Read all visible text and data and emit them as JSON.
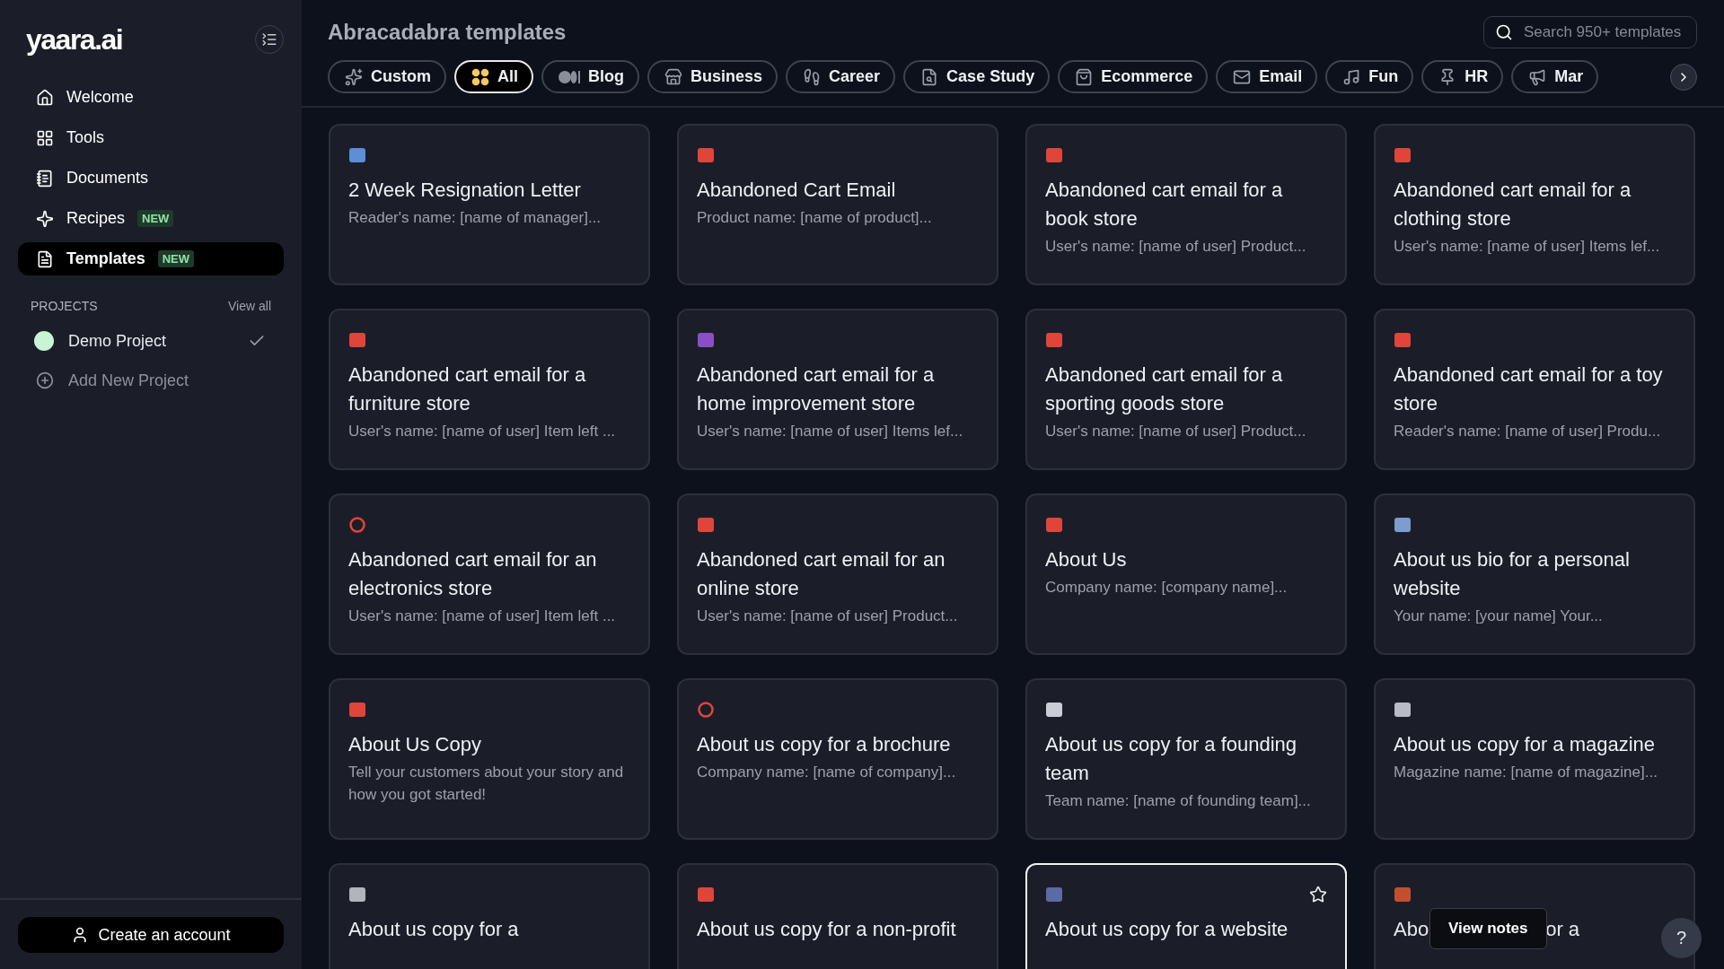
{
  "sidebar": {
    "logo": "yaara.ai",
    "nav": [
      {
        "label": "Welcome",
        "selected": false
      },
      {
        "label": "Tools",
        "selected": false
      },
      {
        "label": "Documents",
        "selected": false
      },
      {
        "label": "Recipes",
        "selected": false,
        "badge": "NEW"
      },
      {
        "label": "Templates",
        "selected": true,
        "badge": "NEW"
      }
    ],
    "projects": {
      "heading": "PROJECTS",
      "view_all": "View all",
      "items": [
        {
          "name": "Demo Project",
          "color": "#c8f5d4",
          "checked": true
        }
      ],
      "add": "Add New Project"
    },
    "account_button": "Create an account"
  },
  "main": {
    "title": "Abracadabra templates",
    "search": {
      "placeholder": "Search 950+ templates"
    },
    "filters": [
      {
        "label": "Custom",
        "selected": false
      },
      {
        "label": "All",
        "selected": true
      },
      {
        "label": "Blog",
        "selected": false
      },
      {
        "label": "Business",
        "selected": false
      },
      {
        "label": "Career",
        "selected": false
      },
      {
        "label": "Case Study",
        "selected": false
      },
      {
        "label": "Ecommerce",
        "selected": false
      },
      {
        "label": "Email",
        "selected": false
      },
      {
        "label": "Fun",
        "selected": false
      },
      {
        "label": "HR",
        "selected": false
      },
      {
        "label": "Mar",
        "selected": false
      }
    ],
    "cards": [
      {
        "title": "2 Week Resignation Letter",
        "description": "Reader's name: [name of manager]...",
        "hovered": false
      },
      {
        "title": "Abandoned Cart Email",
        "description": "Product name: [name of product]...",
        "hovered": false
      },
      {
        "title": "Abandoned cart email for a book store",
        "description": "User's name: [name of user] Product...",
        "hovered": false
      },
      {
        "title": "Abandoned cart email for a clothing store",
        "description": "User's name: [name of user] Items lef...",
        "hovered": false
      },
      {
        "title": "Abandoned cart email for a furniture store",
        "description": "User's name: [name of user] Item left ...",
        "hovered": false
      },
      {
        "title": "Abandoned cart email for a home improvement store",
        "description": "User's name: [name of user] Items lef...",
        "hovered": false
      },
      {
        "title": "Abandoned cart email for a sporting goods store",
        "description": "User's name: [name of user] Product...",
        "hovered": false
      },
      {
        "title": "Abandoned cart email for a toy store",
        "description": "Reader's name: [name of user] Produ...",
        "hovered": false
      },
      {
        "title": "Abandoned cart email for an electronics store",
        "description": "User's name: [name of user] Item left ...",
        "hovered": false
      },
      {
        "title": "Abandoned cart email for an online store",
        "description": "User's name: [name of user] Product...",
        "hovered": false
      },
      {
        "title": "About Us",
        "description": "Company name: [company name]...",
        "hovered": false
      },
      {
        "title": "About us bio for a personal website",
        "description": "Your name: [your name] Your...",
        "hovered": false
      },
      {
        "title": "About Us Copy",
        "description": "Tell your customers about your story and how you got started!",
        "hovered": false
      },
      {
        "title": "About us copy for a brochure",
        "description": "Company name: [name of company]...",
        "hovered": false
      },
      {
        "title": "About us copy for a founding team",
        "description": "Team name: [name of founding team]...",
        "hovered": false
      },
      {
        "title": "About us copy for a magazine",
        "description": "Magazine name: [name of magazine]...",
        "hovered": false
      },
      {
        "title": "About us copy for a",
        "hovered": false
      },
      {
        "title": "About us copy for a non-profit",
        "hovered": false
      },
      {
        "title": "About us copy for a website",
        "hovered": true
      },
      {
        "title_parts": [
          "Abo",
          "or a"
        ],
        "hovered": false,
        "tooltip": "View notes"
      }
    ]
  },
  "help_button": "?"
}
